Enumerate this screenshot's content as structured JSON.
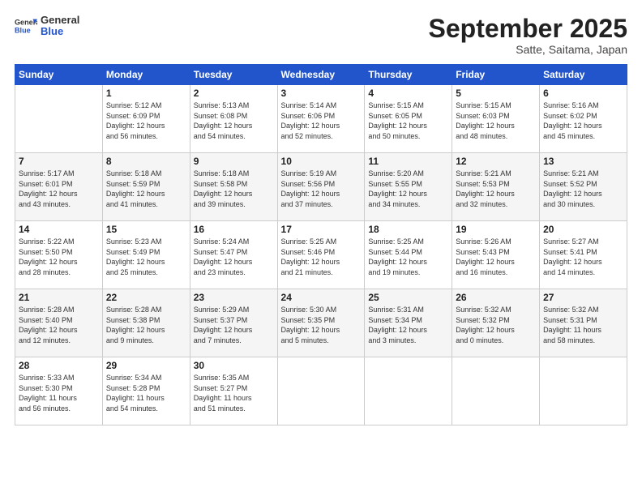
{
  "header": {
    "logo_general": "General",
    "logo_blue": "Blue",
    "month_title": "September 2025",
    "subtitle": "Satte, Saitama, Japan"
  },
  "days_of_week": [
    "Sunday",
    "Monday",
    "Tuesday",
    "Wednesday",
    "Thursday",
    "Friday",
    "Saturday"
  ],
  "weeks": [
    [
      {
        "day": "",
        "info": ""
      },
      {
        "day": "1",
        "info": "Sunrise: 5:12 AM\nSunset: 6:09 PM\nDaylight: 12 hours\nand 56 minutes."
      },
      {
        "day": "2",
        "info": "Sunrise: 5:13 AM\nSunset: 6:08 PM\nDaylight: 12 hours\nand 54 minutes."
      },
      {
        "day": "3",
        "info": "Sunrise: 5:14 AM\nSunset: 6:06 PM\nDaylight: 12 hours\nand 52 minutes."
      },
      {
        "day": "4",
        "info": "Sunrise: 5:15 AM\nSunset: 6:05 PM\nDaylight: 12 hours\nand 50 minutes."
      },
      {
        "day": "5",
        "info": "Sunrise: 5:15 AM\nSunset: 6:03 PM\nDaylight: 12 hours\nand 48 minutes."
      },
      {
        "day": "6",
        "info": "Sunrise: 5:16 AM\nSunset: 6:02 PM\nDaylight: 12 hours\nand 45 minutes."
      }
    ],
    [
      {
        "day": "7",
        "info": "Sunrise: 5:17 AM\nSunset: 6:01 PM\nDaylight: 12 hours\nand 43 minutes."
      },
      {
        "day": "8",
        "info": "Sunrise: 5:18 AM\nSunset: 5:59 PM\nDaylight: 12 hours\nand 41 minutes."
      },
      {
        "day": "9",
        "info": "Sunrise: 5:18 AM\nSunset: 5:58 PM\nDaylight: 12 hours\nand 39 minutes."
      },
      {
        "day": "10",
        "info": "Sunrise: 5:19 AM\nSunset: 5:56 PM\nDaylight: 12 hours\nand 37 minutes."
      },
      {
        "day": "11",
        "info": "Sunrise: 5:20 AM\nSunset: 5:55 PM\nDaylight: 12 hours\nand 34 minutes."
      },
      {
        "day": "12",
        "info": "Sunrise: 5:21 AM\nSunset: 5:53 PM\nDaylight: 12 hours\nand 32 minutes."
      },
      {
        "day": "13",
        "info": "Sunrise: 5:21 AM\nSunset: 5:52 PM\nDaylight: 12 hours\nand 30 minutes."
      }
    ],
    [
      {
        "day": "14",
        "info": "Sunrise: 5:22 AM\nSunset: 5:50 PM\nDaylight: 12 hours\nand 28 minutes."
      },
      {
        "day": "15",
        "info": "Sunrise: 5:23 AM\nSunset: 5:49 PM\nDaylight: 12 hours\nand 25 minutes."
      },
      {
        "day": "16",
        "info": "Sunrise: 5:24 AM\nSunset: 5:47 PM\nDaylight: 12 hours\nand 23 minutes."
      },
      {
        "day": "17",
        "info": "Sunrise: 5:25 AM\nSunset: 5:46 PM\nDaylight: 12 hours\nand 21 minutes."
      },
      {
        "day": "18",
        "info": "Sunrise: 5:25 AM\nSunset: 5:44 PM\nDaylight: 12 hours\nand 19 minutes."
      },
      {
        "day": "19",
        "info": "Sunrise: 5:26 AM\nSunset: 5:43 PM\nDaylight: 12 hours\nand 16 minutes."
      },
      {
        "day": "20",
        "info": "Sunrise: 5:27 AM\nSunset: 5:41 PM\nDaylight: 12 hours\nand 14 minutes."
      }
    ],
    [
      {
        "day": "21",
        "info": "Sunrise: 5:28 AM\nSunset: 5:40 PM\nDaylight: 12 hours\nand 12 minutes."
      },
      {
        "day": "22",
        "info": "Sunrise: 5:28 AM\nSunset: 5:38 PM\nDaylight: 12 hours\nand 9 minutes."
      },
      {
        "day": "23",
        "info": "Sunrise: 5:29 AM\nSunset: 5:37 PM\nDaylight: 12 hours\nand 7 minutes."
      },
      {
        "day": "24",
        "info": "Sunrise: 5:30 AM\nSunset: 5:35 PM\nDaylight: 12 hours\nand 5 minutes."
      },
      {
        "day": "25",
        "info": "Sunrise: 5:31 AM\nSunset: 5:34 PM\nDaylight: 12 hours\nand 3 minutes."
      },
      {
        "day": "26",
        "info": "Sunrise: 5:32 AM\nSunset: 5:32 PM\nDaylight: 12 hours\nand 0 minutes."
      },
      {
        "day": "27",
        "info": "Sunrise: 5:32 AM\nSunset: 5:31 PM\nDaylight: 11 hours\nand 58 minutes."
      }
    ],
    [
      {
        "day": "28",
        "info": "Sunrise: 5:33 AM\nSunset: 5:30 PM\nDaylight: 11 hours\nand 56 minutes."
      },
      {
        "day": "29",
        "info": "Sunrise: 5:34 AM\nSunset: 5:28 PM\nDaylight: 11 hours\nand 54 minutes."
      },
      {
        "day": "30",
        "info": "Sunrise: 5:35 AM\nSunset: 5:27 PM\nDaylight: 11 hours\nand 51 minutes."
      },
      {
        "day": "",
        "info": ""
      },
      {
        "day": "",
        "info": ""
      },
      {
        "day": "",
        "info": ""
      },
      {
        "day": "",
        "info": ""
      }
    ]
  ]
}
